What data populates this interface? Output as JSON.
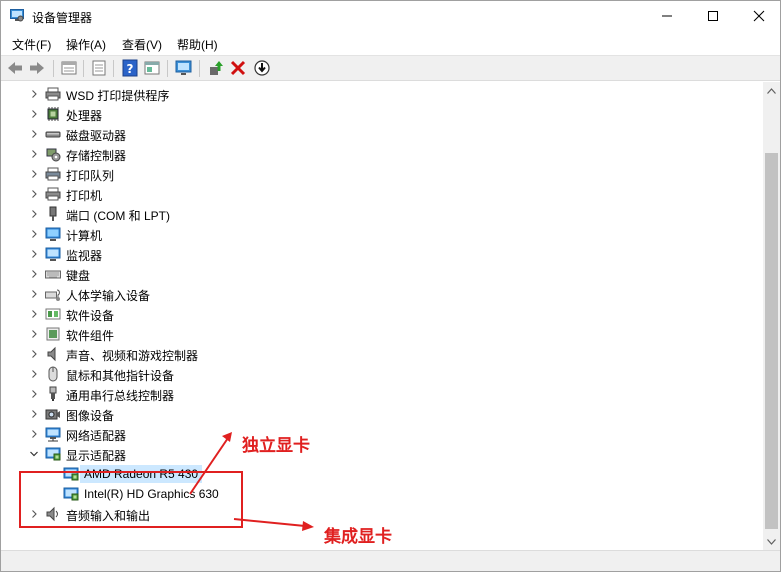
{
  "window": {
    "title": "设备管理器",
    "icon": "device-manager-icon"
  },
  "menu": [
    {
      "label": "文件(F)"
    },
    {
      "label": "操作(A)"
    },
    {
      "label": "查看(V)"
    },
    {
      "label": "帮助(H)"
    }
  ],
  "toolbar": [
    {
      "icon": "back-arrow-icon"
    },
    {
      "icon": "forward-arrow-icon"
    },
    {
      "icon": "properties-icon"
    },
    {
      "icon": "console-tree-icon"
    },
    {
      "icon": "help-icon"
    },
    {
      "icon": "show-hide-pane-icon"
    },
    {
      "icon": "monitor-scan-icon"
    },
    {
      "icon": "update-driver-icon"
    },
    {
      "icon": "uninstall-x-icon"
    },
    {
      "icon": "download-driver-icon"
    }
  ],
  "tree": [
    {
      "label": "WSD 打印提供程序",
      "icon": "printer-icon",
      "expanded": false
    },
    {
      "label": "处理器",
      "icon": "processor-icon",
      "expanded": false
    },
    {
      "label": "磁盘驱动器",
      "icon": "disk-drive-icon",
      "expanded": false
    },
    {
      "label": "存储控制器",
      "icon": "storage-controller-icon",
      "expanded": false
    },
    {
      "label": "打印队列",
      "icon": "print-queue-icon",
      "expanded": false
    },
    {
      "label": "打印机",
      "icon": "printer-icon",
      "expanded": false
    },
    {
      "label": "端口 (COM 和 LPT)",
      "icon": "port-icon",
      "expanded": false
    },
    {
      "label": "计算机",
      "icon": "computer-icon",
      "expanded": false
    },
    {
      "label": "监视器",
      "icon": "monitor-icon",
      "expanded": false
    },
    {
      "label": "键盘",
      "icon": "keyboard-icon",
      "expanded": false
    },
    {
      "label": "人体学输入设备",
      "icon": "hid-icon",
      "expanded": false
    },
    {
      "label": "软件设备",
      "icon": "software-device-icon",
      "expanded": false
    },
    {
      "label": "软件组件",
      "icon": "software-component-icon",
      "expanded": false
    },
    {
      "label": "声音、视频和游戏控制器",
      "icon": "speaker-icon",
      "expanded": false
    },
    {
      "label": "鼠标和其他指针设备",
      "icon": "mouse-icon",
      "expanded": false
    },
    {
      "label": "通用串行总线控制器",
      "icon": "usb-icon",
      "expanded": false
    },
    {
      "label": "图像设备",
      "icon": "camera-icon",
      "expanded": false
    },
    {
      "label": "网络适配器",
      "icon": "network-adapter-icon",
      "expanded": false
    },
    {
      "label": "显示适配器",
      "icon": "display-adapter-icon",
      "expanded": true
    },
    {
      "label": "AMD Radeon R5 430",
      "icon": "display-adapter-icon",
      "child": true,
      "selected": true
    },
    {
      "label": "Intel(R) HD Graphics 630",
      "icon": "display-adapter-icon",
      "child": true
    },
    {
      "label": "音频输入和输出",
      "icon": "audio-io-icon",
      "expanded": false
    }
  ],
  "annotations": {
    "discrete_gpu": "独立显卡",
    "integrated_gpu": "集成显卡",
    "color": "#e02020"
  },
  "colors": {
    "selection": "#cce8ff",
    "toolbar_bg": "#f0f0f0"
  }
}
